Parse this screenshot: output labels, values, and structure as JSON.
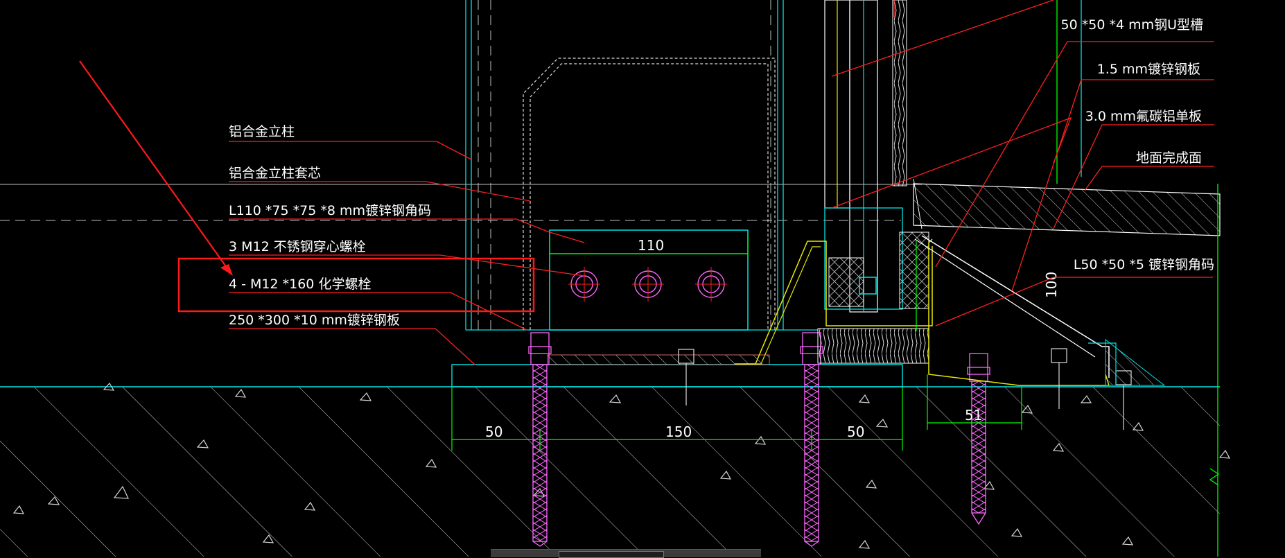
{
  "labels_left": [
    {
      "id": "aluminum-mullion",
      "text": "铝合金立柱"
    },
    {
      "id": "mullion-sleeve",
      "text": "铝合金立柱套芯"
    },
    {
      "id": "angle-bracket",
      "text": "L110 *75 *75 *8 mm镀锌钢角码"
    },
    {
      "id": "through-bolt",
      "text": "3 M12 不锈钢穿心螺栓"
    },
    {
      "id": "chemical-bolt",
      "text": "4 - M12 *160 化学螺栓"
    },
    {
      "id": "steel-plate",
      "text": "250 *300 *10 mm镀锌钢板"
    }
  ],
  "labels_right": [
    {
      "id": "u-channel",
      "text": "50 *50 *4 mm钢U型槽"
    },
    {
      "id": "galv-sheet",
      "text": "1.5 mm镀锌钢板"
    },
    {
      "id": "al-panel",
      "text": "3.0 mm氟碳铝单板"
    },
    {
      "id": "floor-finish",
      "text": "地面完成面"
    },
    {
      "id": "small-angle",
      "text": "L50 *50 *5 镀锌钢角码"
    }
  ],
  "dimensions": {
    "bracket_width": "110",
    "plate_left": "50",
    "plate_middle": "150",
    "plate_right": "50",
    "channel_width": "51",
    "vertical": "100"
  },
  "colors": {
    "background": "#000000",
    "leader": "#ff2020",
    "cyan": "#00e5e5",
    "yellow": "#e8e800",
    "green": "#00ff00",
    "bolt": "#ff66ff",
    "white": "#ffffff",
    "highlight": "#ff1a1a"
  }
}
